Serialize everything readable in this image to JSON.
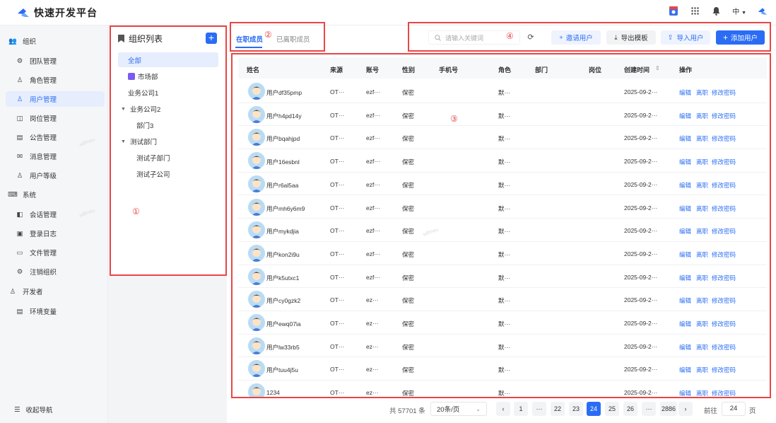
{
  "app": {
    "title": "快速开发平台"
  },
  "header": {
    "lang": "中"
  },
  "sidebar": {
    "groups": [
      {
        "label": "组织",
        "icon": "users-icon",
        "items": [
          "团队管理",
          "角色管理",
          "用户管理",
          "岗位管理",
          "公告管理",
          "消息管理",
          "用户等级"
        ]
      },
      {
        "label": "系统",
        "icon": "keyboard-icon",
        "items": [
          "会话管理",
          "登录日志",
          "文件管理",
          "注销组织"
        ]
      },
      {
        "label": "开发者",
        "icon": "user-icon",
        "items": [
          "环境变量"
        ]
      }
    ],
    "active": "用户管理",
    "collapse_label": "收起导航"
  },
  "org": {
    "title": "组织列表",
    "tree": [
      "全部",
      "市场部",
      "业务公司1",
      "业务公司2",
      "部门3",
      "测试部门",
      "测试子部门",
      "测试子公司"
    ]
  },
  "tabs": [
    "在职成员",
    "已离职成员"
  ],
  "annotations": {
    "one": "①",
    "two": "②",
    "three": "③",
    "four": "④"
  },
  "toolbar": {
    "search_placeholder": "请输入关键词",
    "invite": "邀请用户",
    "export": "导出模板",
    "import": "导入用户",
    "add": "添加用户"
  },
  "table": {
    "columns": [
      "姓名",
      "来源",
      "账号",
      "性别",
      "手机号",
      "角色",
      "部门",
      "岗位",
      "创建时间",
      "操作"
    ],
    "rows": [
      {
        "name": "用户df35pmp",
        "source": "OT···",
        "account": "ezf···",
        "gender": "保密",
        "phone": "",
        "role": "默···",
        "created": "2025-09-2···"
      },
      {
        "name": "用户h4pd14y",
        "source": "OT···",
        "account": "ezf···",
        "gender": "保密",
        "phone": "",
        "role": "默···",
        "created": "2025-09-2···"
      },
      {
        "name": "用户bqahjpd",
        "source": "OT···",
        "account": "ezf···",
        "gender": "保密",
        "phone": "",
        "role": "默···",
        "created": "2025-09-2···"
      },
      {
        "name": "用户16esbnl",
        "source": "OT···",
        "account": "ezf···",
        "gender": "保密",
        "phone": "",
        "role": "默···",
        "created": "2025-09-2···"
      },
      {
        "name": "用户r6al5aa",
        "source": "OT···",
        "account": "ezf···",
        "gender": "保密",
        "phone": "",
        "role": "默···",
        "created": "2025-09-2···"
      },
      {
        "name": "用户mh6y6m9",
        "source": "OT···",
        "account": "ezf···",
        "gender": "保密",
        "phone": "",
        "role": "默···",
        "created": "2025-09-2···"
      },
      {
        "name": "用户mykdjia",
        "source": "OT···",
        "account": "ezf···",
        "gender": "保密",
        "phone": "",
        "role": "默···",
        "created": "2025-09-2···"
      },
      {
        "name": "用户kon2i9u",
        "source": "OT···",
        "account": "ezf···",
        "gender": "保密",
        "phone": "",
        "role": "默···",
        "created": "2025-09-2···"
      },
      {
        "name": "用户k5utxc1",
        "source": "OT···",
        "account": "ezf···",
        "gender": "保密",
        "phone": "",
        "role": "默···",
        "created": "2025-09-2···"
      },
      {
        "name": "用户cy0gzk2",
        "source": "OT···",
        "account": "ez···",
        "gender": "保密",
        "phone": "",
        "role": "默···",
        "created": "2025-09-2···"
      },
      {
        "name": "用户ewq07ia",
        "source": "OT···",
        "account": "ez···",
        "gender": "保密",
        "phone": "",
        "role": "默···",
        "created": "2025-09-2···"
      },
      {
        "name": "用户lw33rb5",
        "source": "OT···",
        "account": "ez···",
        "gender": "保密",
        "phone": "",
        "role": "默···",
        "created": "2025-09-2···"
      },
      {
        "name": "用户tuu4j5u",
        "source": "OT···",
        "account": "ez···",
        "gender": "保密",
        "phone": "",
        "role": "默···",
        "created": "2025-09-2···"
      },
      {
        "name": "1234",
        "source": "OT···",
        "account": "ez···",
        "gender": "保密",
        "phone": "",
        "role": "默···",
        "created": "2025-09-2···"
      }
    ],
    "actions": [
      "编辑",
      "离职",
      "修改密码"
    ]
  },
  "pager": {
    "total": "共 57701 条",
    "size": "20条/页",
    "pages": [
      "1",
      "···",
      "22",
      "23",
      "24",
      "25",
      "26",
      "···",
      "2886"
    ],
    "current": "24",
    "goto_label": "前往",
    "goto_value": "24",
    "goto_suffix": "页"
  },
  "colors": {
    "accent": "#2a6df4",
    "annotation": "#e94545"
  }
}
